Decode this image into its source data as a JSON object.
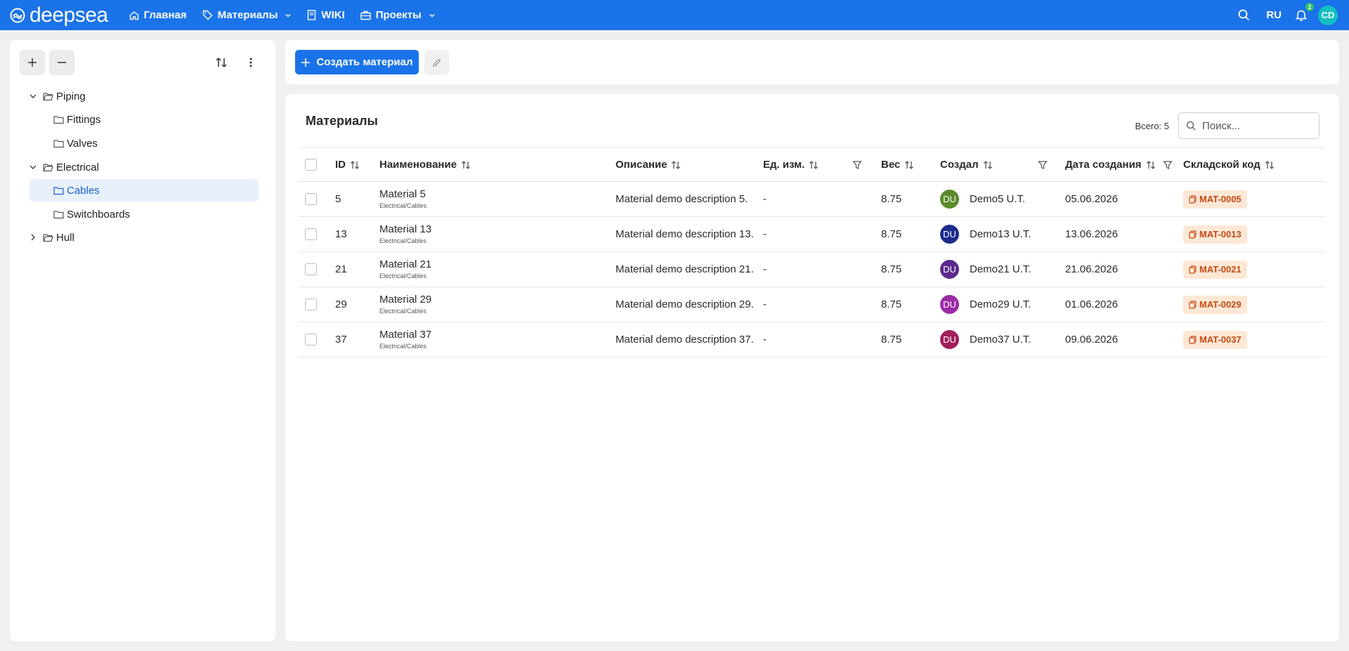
{
  "brand": {
    "name": "deepsea"
  },
  "nav": {
    "home": "Главная",
    "materials": "Материалы",
    "wiki": "WIKI",
    "projects": "Проекты"
  },
  "topbar": {
    "lang": "RU",
    "notifications_count": "2",
    "user_initials": "CD"
  },
  "tree": {
    "items": [
      {
        "label": "Piping",
        "expanded": true,
        "level": 0
      },
      {
        "label": "Fittings",
        "level": 1
      },
      {
        "label": "Valves",
        "level": 1
      },
      {
        "label": "Electrical",
        "expanded": true,
        "level": 0
      },
      {
        "label": "Cables",
        "level": 1,
        "selected": true
      },
      {
        "label": "Switchboards",
        "level": 1
      },
      {
        "label": "Hull",
        "expanded": false,
        "level": 0
      }
    ]
  },
  "toolbar": {
    "create_label": "Создать материал"
  },
  "main": {
    "title": "Материалы",
    "total": "Всего: 5",
    "search_placeholder": "Поиск..."
  },
  "table": {
    "columns": {
      "id": "ID",
      "name": "Наименование",
      "description": "Описание",
      "unit": "Ед. изм.",
      "weight": "Вес",
      "creator": "Создал",
      "created": "Дата создания",
      "code": "Складской код"
    },
    "rows": [
      {
        "id": "5",
        "name": "Material 5",
        "path": "Electrical/Cables",
        "description": "Material demo description 5.",
        "unit": "-",
        "weight": "8.75",
        "avatar": "DU",
        "avatar_color": "#5a8a2a",
        "creator": "Demo5 U.T.",
        "created": "05.06.2026",
        "code": "MAT-0005"
      },
      {
        "id": "13",
        "name": "Material 13",
        "path": "Electrical/Cables",
        "description": "Material demo description 13.",
        "unit": "-",
        "weight": "8.75",
        "avatar": "DU",
        "avatar_color": "#1e2a8c",
        "creator": "Demo13 U.T.",
        "created": "13.06.2026",
        "code": "MAT-0013"
      },
      {
        "id": "21",
        "name": "Material 21",
        "path": "Electrical/Cables",
        "description": "Material demo description 21.",
        "unit": "-",
        "weight": "8.75",
        "avatar": "DU",
        "avatar_color": "#5b2a8c",
        "creator": "Demo21 U.T.",
        "created": "21.06.2026",
        "code": "MAT-0021"
      },
      {
        "id": "29",
        "name": "Material 29",
        "path": "Electrical/Cables",
        "description": "Material demo description 29.",
        "unit": "-",
        "weight": "8.75",
        "avatar": "DU",
        "avatar_color": "#9c2aa8",
        "creator": "Demo29 U.T.",
        "created": "01.06.2026",
        "code": "MAT-0029"
      },
      {
        "id": "37",
        "name": "Material 37",
        "path": "Electrical/Cables",
        "description": "Material demo description 37.",
        "unit": "-",
        "weight": "8.75",
        "avatar": "DU",
        "avatar_color": "#a01e5a",
        "creator": "Demo37 U.T.",
        "created": "09.06.2026",
        "code": "MAT-0037"
      }
    ]
  },
  "colors": {
    "primary": "#1a73e8",
    "selected_bg": "#e8f0fb",
    "chip_bg": "#fde8d6",
    "chip_text": "#c64a12"
  }
}
